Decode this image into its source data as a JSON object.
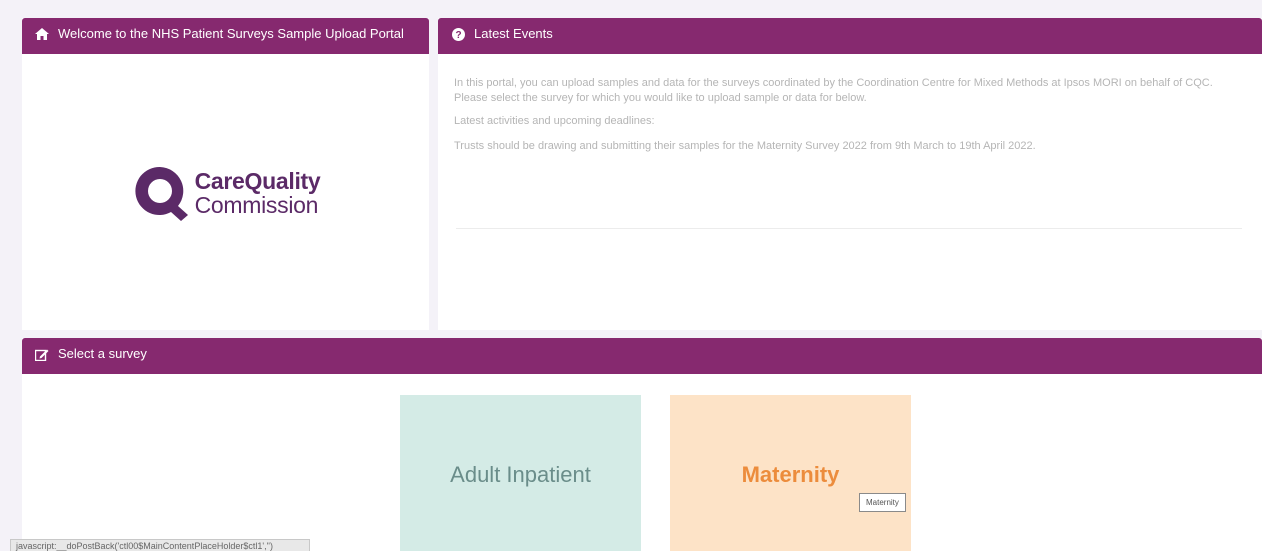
{
  "welcome": {
    "title": "Welcome to the NHS Patient Surveys Sample Upload Portal",
    "icon": "home-icon",
    "logo": {
      "line1": "CareQuality",
      "line2": "Commission"
    }
  },
  "events": {
    "title": "Latest Events",
    "icon": "question-circle-icon",
    "paragraph1": "In this portal, you can upload samples and data for the surveys coordinated by the Coordination Centre for Mixed Methods at Ipsos MORI on behalf of CQC.",
    "paragraph2": "Please select the survey for which you would like to upload sample or data for below.",
    "paragraph3": "Latest activities and upcoming deadlines:",
    "paragraph4": "Trusts should be drawing and submitting their samples for the Maternity Survey 2022 from 9th March to 19th April 2022."
  },
  "survey": {
    "title": "Select a survey",
    "icon": "edit-icon",
    "tiles": [
      {
        "label": "Adult Inpatient",
        "color": "#d4ebe6"
      },
      {
        "label": "Maternity",
        "color": "#fde3c7"
      }
    ]
  },
  "tooltip": "Maternity",
  "status_bar": "javascript:__doPostBack('ctl00$MainContentPlaceHolder$ctl1','')",
  "colors": {
    "header": "#86296f",
    "brand": "#5b2a67",
    "accent_orange": "#ec8c3c"
  }
}
